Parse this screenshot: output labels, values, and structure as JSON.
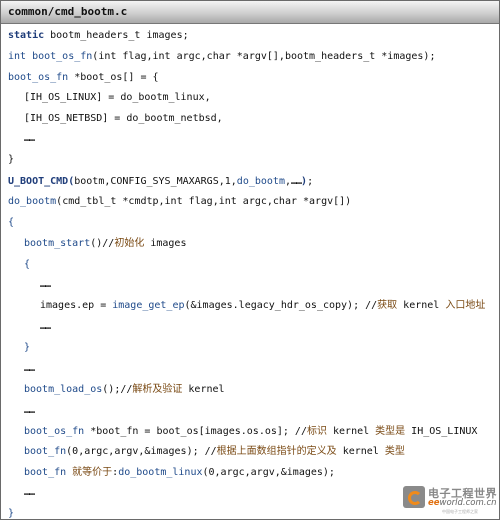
{
  "title": "common/cmd_bootm.c",
  "colors": {
    "keyword": "#1f3d7a",
    "identifier": "#1f4a8a",
    "comment": "#7a4a14",
    "text": "#111111"
  },
  "lines": [
    {
      "indent": 0,
      "segs": [
        {
          "c": "k",
          "t": "static"
        },
        {
          "c": "p",
          "t": " bootm_headers_t images;"
        }
      ]
    },
    {
      "indent": 0,
      "segs": [
        {
          "c": "f",
          "t": "int boot_os_fn"
        },
        {
          "c": "p",
          "t": "(int flag,int argc,char *argv[],bootm_headers_t *images);"
        }
      ]
    },
    {
      "indent": 0,
      "segs": [
        {
          "c": "f",
          "t": "boot_os_fn"
        },
        {
          "c": "p",
          "t": " *boot_os[] = {"
        }
      ]
    },
    {
      "indent": 1,
      "segs": [
        {
          "c": "p",
          "t": "[IH_OS_LINUX] = do_bootm_linux,"
        }
      ]
    },
    {
      "indent": 1,
      "segs": [
        {
          "c": "p",
          "t": "[IH_OS_NETBSD] = do_bootm_netbsd,"
        }
      ]
    },
    {
      "indent": 1,
      "segs": [
        {
          "c": "d",
          "t": "……"
        }
      ]
    },
    {
      "indent": 0,
      "segs": [
        {
          "c": "p",
          "t": "}"
        }
      ]
    },
    {
      "indent": 0,
      "segs": [
        {
          "c": "k",
          "t": "U_BOOT_CMD("
        },
        {
          "c": "p",
          "t": "bootm,CONFIG_SYS_MAXARGS,1,"
        },
        {
          "c": "f",
          "t": "do_bootm"
        },
        {
          "c": "p",
          "t": ","
        },
        {
          "c": "d",
          "t": "……"
        },
        {
          "c": "k",
          "t": ")"
        },
        {
          "c": "p",
          "t": ";"
        }
      ]
    },
    {
      "indent": 0,
      "segs": [
        {
          "c": "f",
          "t": "do_bootm"
        },
        {
          "c": "p",
          "t": "(cmd_tbl_t *cmdtp,int flag,int argc,char *argv[])"
        }
      ]
    },
    {
      "indent": 0,
      "segs": [
        {
          "c": "f",
          "t": "{"
        }
      ]
    },
    {
      "indent": 1,
      "segs": [
        {
          "c": "f",
          "t": "bootm_start"
        },
        {
          "c": "p",
          "t": "()//"
        },
        {
          "c": "m",
          "t": "初始化"
        },
        {
          "c": "p",
          "t": " images"
        }
      ]
    },
    {
      "indent": 1,
      "segs": [
        {
          "c": "f",
          "t": "{"
        }
      ]
    },
    {
      "indent": 2,
      "segs": [
        {
          "c": "d",
          "t": "……"
        }
      ]
    },
    {
      "indent": 2,
      "segs": [
        {
          "c": "p",
          "t": "images.ep = "
        },
        {
          "c": "f",
          "t": "image_get_ep"
        },
        {
          "c": "p",
          "t": "(&images.legacy_hdr_os_copy); //"
        },
        {
          "c": "m",
          "t": "获取"
        },
        {
          "c": "p",
          "t": " kernel "
        },
        {
          "c": "m",
          "t": "入口地址"
        }
      ]
    },
    {
      "indent": 2,
      "segs": [
        {
          "c": "d",
          "t": "……"
        }
      ]
    },
    {
      "indent": 1,
      "segs": [
        {
          "c": "f",
          "t": "}"
        }
      ]
    },
    {
      "indent": 1,
      "segs": [
        {
          "c": "d",
          "t": "……"
        }
      ]
    },
    {
      "indent": 1,
      "segs": [
        {
          "c": "f",
          "t": "bootm_load_os"
        },
        {
          "c": "p",
          "t": "();//"
        },
        {
          "c": "m",
          "t": "解析及验证"
        },
        {
          "c": "p",
          "t": " kernel"
        }
      ]
    },
    {
      "indent": 1,
      "segs": [
        {
          "c": "d",
          "t": "……"
        }
      ]
    },
    {
      "indent": 1,
      "segs": [
        {
          "c": "f",
          "t": "boot_os_fn"
        },
        {
          "c": "p",
          "t": " *boot_fn = boot_os[images.os.os]; //"
        },
        {
          "c": "m",
          "t": "标识"
        },
        {
          "c": "p",
          "t": " kernel "
        },
        {
          "c": "m",
          "t": "类型是"
        },
        {
          "c": "p",
          "t": " IH_OS_LINUX"
        }
      ]
    },
    {
      "indent": 1,
      "segs": [
        {
          "c": "f",
          "t": "boot_fn"
        },
        {
          "c": "p",
          "t": "(0,argc,argv,&images); //"
        },
        {
          "c": "m",
          "t": "根据上面数组指针的定义及"
        },
        {
          "c": "p",
          "t": " kernel "
        },
        {
          "c": "m",
          "t": "类型"
        }
      ]
    },
    {
      "indent": 1,
      "segs": [
        {
          "c": "f",
          "t": "boot_fn "
        },
        {
          "c": "m",
          "t": "就等价于"
        },
        {
          "c": "p",
          "t": ":"
        },
        {
          "c": "f",
          "t": "do_bootm_linux"
        },
        {
          "c": "p",
          "t": "(0,argc,argv,&images);"
        }
      ]
    },
    {
      "indent": 1,
      "segs": [
        {
          "c": "d",
          "t": "……"
        }
      ]
    },
    {
      "indent": 0,
      "segs": [
        {
          "c": "f",
          "t": "}"
        }
      ]
    }
  ],
  "watermark": {
    "cn": "电子工程世界",
    "en_prefix": "ee",
    "en_rest": "world.com.cn",
    "sub": "中国电子工程师之家"
  }
}
